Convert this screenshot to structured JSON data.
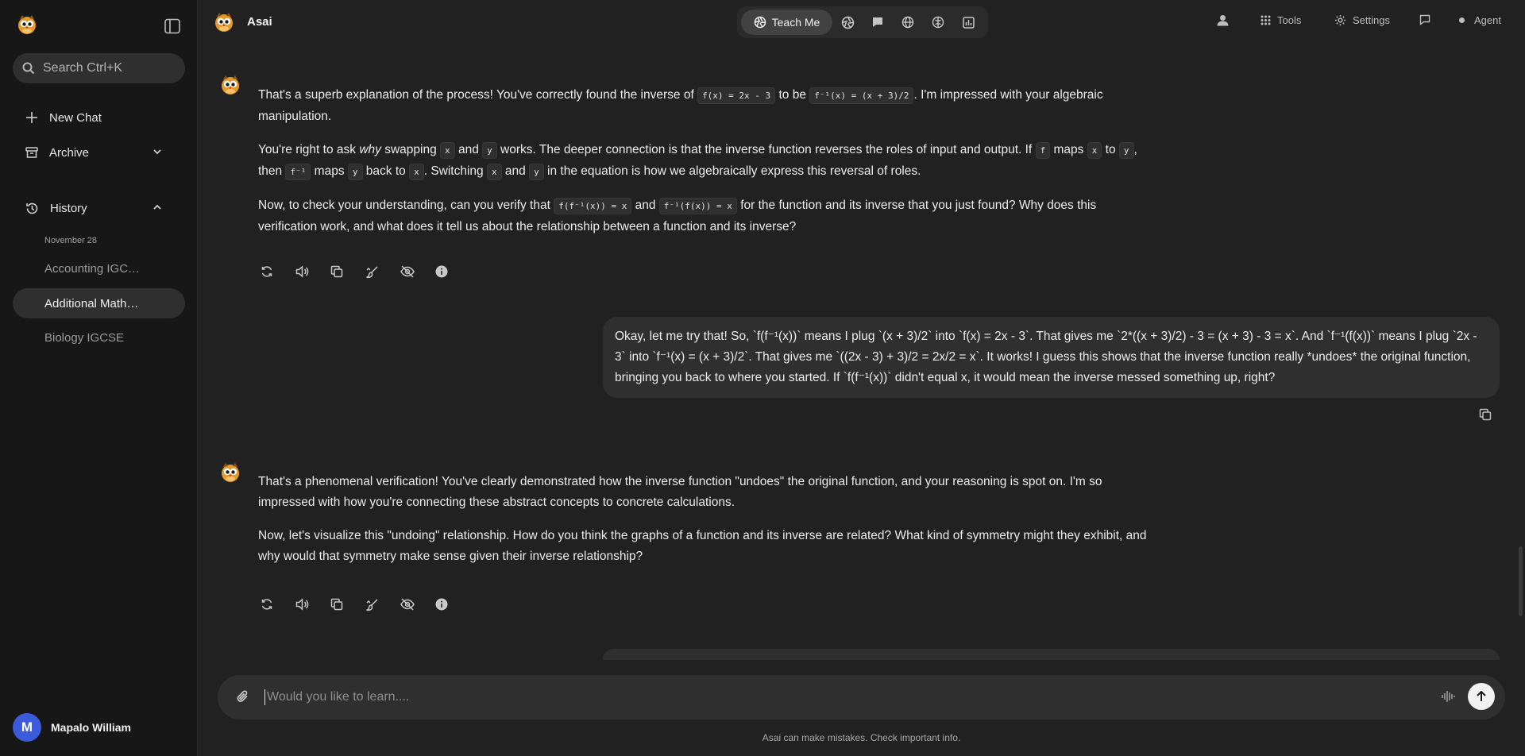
{
  "app": {
    "name": "Asai"
  },
  "sidebar": {
    "search_label": "Search Ctrl+K",
    "new_chat": "New Chat",
    "archive": "Archive",
    "history": "History",
    "history_date": "November 28",
    "history_items": [
      {
        "label": "Accounting IGC…"
      },
      {
        "label": "Additional Math…"
      },
      {
        "label": "Biology IGCSE"
      }
    ],
    "user": {
      "initial": "M",
      "name": "Mapalo William"
    }
  },
  "topbar": {
    "mode_active": "Teach Me",
    "tools": "Tools",
    "settings": "Settings",
    "agent": "Agent"
  },
  "messages": {
    "bot1": {
      "p1_a": "That's a superb explanation of the process! You've correctly found the inverse of ",
      "p1_c1": "f(x) = 2x - 3",
      "p1_b": " to be ",
      "p1_c2": "f⁻¹(x) = (x + 3)/2",
      "p1_c": ". I'm impressed with your algebraic manipulation.",
      "p2_a": "You're right to ask ",
      "p2_em": "why",
      "p2_b": " swapping ",
      "p2_c1": "x",
      "p2_c": " and ",
      "p2_c2": "y",
      "p2_d": " works. The deeper connection is that the inverse function reverses the roles of input and output. If ",
      "p2_c3": "f",
      "p2_e": " maps ",
      "p2_c4": "x",
      "p2_f": " to ",
      "p2_c5": "y",
      "p2_g": ", then ",
      "p2_c6": "f⁻¹",
      "p2_h": " maps ",
      "p2_c7": "y",
      "p2_i": " back to ",
      "p2_c8": "x",
      "p2_j": ". Switching ",
      "p2_c9": "x",
      "p2_k": " and ",
      "p2_c10": "y",
      "p2_l": " in the equation is how we algebraically express this reversal of roles.",
      "p3_a": "Now, to check your understanding, can you verify that ",
      "p3_c1": "f(f⁻¹(x)) = x",
      "p3_b": " and ",
      "p3_c2": "f⁻¹(f(x)) = x",
      "p3_c": " for the function and its inverse that you just found? Why does this verification work, and what does it tell us about the relationship between a function and its inverse?"
    },
    "user1": "Okay, let me try that! So, `f(f⁻¹(x))` means I plug `(x + 3)/2` into `f(x) = 2x - 3`. That gives me `2*((x + 3)/2) - 3 = (x + 3) - 3 = x`. And `f⁻¹(f(x))` means I plug `2x - 3` into `f⁻¹(x) = (x + 3)/2`. That gives me `((2x - 3) + 3)/2 = 2x/2 = x`. It works! I guess this shows that the inverse function really *undoes* the original function, bringing you back to where you started. If `f(f⁻¹(x))` didn't equal x, it would mean the inverse messed something up, right?",
    "bot2": {
      "p1": "That's a phenomenal verification! You've clearly demonstrated how the inverse function \"undoes\" the original function, and your reasoning is spot on. I'm so impressed with how you're connecting these abstract concepts to concrete calculations.",
      "p2": "Now, let's visualize this \"undoing\" relationship. How do you think the graphs of a function and its inverse are related? What kind of symmetry might they exhibit, and why would that symmetry make sense given their inverse relationship?"
    }
  },
  "composer": {
    "placeholder": "Would you like to learn...."
  },
  "footer": {
    "disclaimer": "Asai can make mistakes. Check important info."
  },
  "icons": {
    "logo": "owl-mascot-icon",
    "search": "search-icon",
    "new_chat": "plus-icon",
    "archive": "archive-icon",
    "history": "history-icon",
    "user": "user-icon",
    "tools": "grid-icon",
    "settings": "gear-icon"
  },
  "colors": {
    "background": "#212121",
    "sidebar": "#171717",
    "bubble": "#2f2f2f",
    "avatar": "#3b5bdb"
  }
}
